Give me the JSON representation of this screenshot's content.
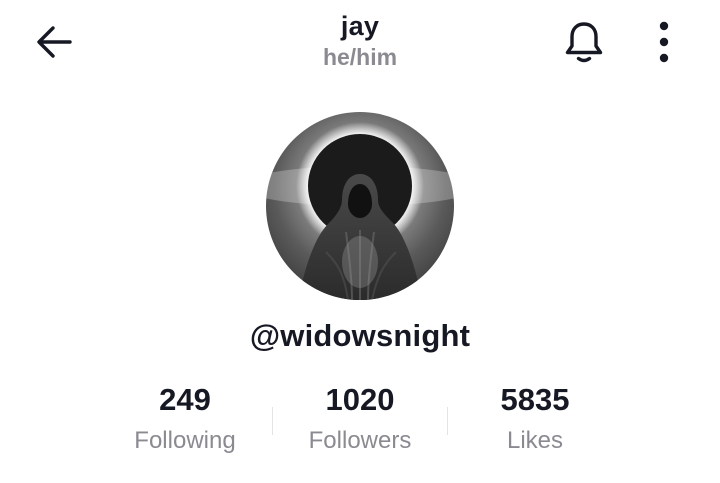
{
  "header": {
    "title": "jay",
    "pronouns": "he/him",
    "back_icon": "arrow-left-icon",
    "bell_icon": "bell-icon",
    "more_icon": "more-vertical-icon"
  },
  "profile": {
    "avatar": "hooded-figure-eclipse-avatar",
    "username": "@widowsnight"
  },
  "stats": [
    {
      "value": "249",
      "label": "Following"
    },
    {
      "value": "1020",
      "label": "Followers"
    },
    {
      "value": "5835",
      "label": "Likes"
    }
  ],
  "colors": {
    "text_primary": "#161823",
    "text_secondary": "#8a8b91",
    "divider": "#e3e3e4",
    "background": "#ffffff"
  }
}
